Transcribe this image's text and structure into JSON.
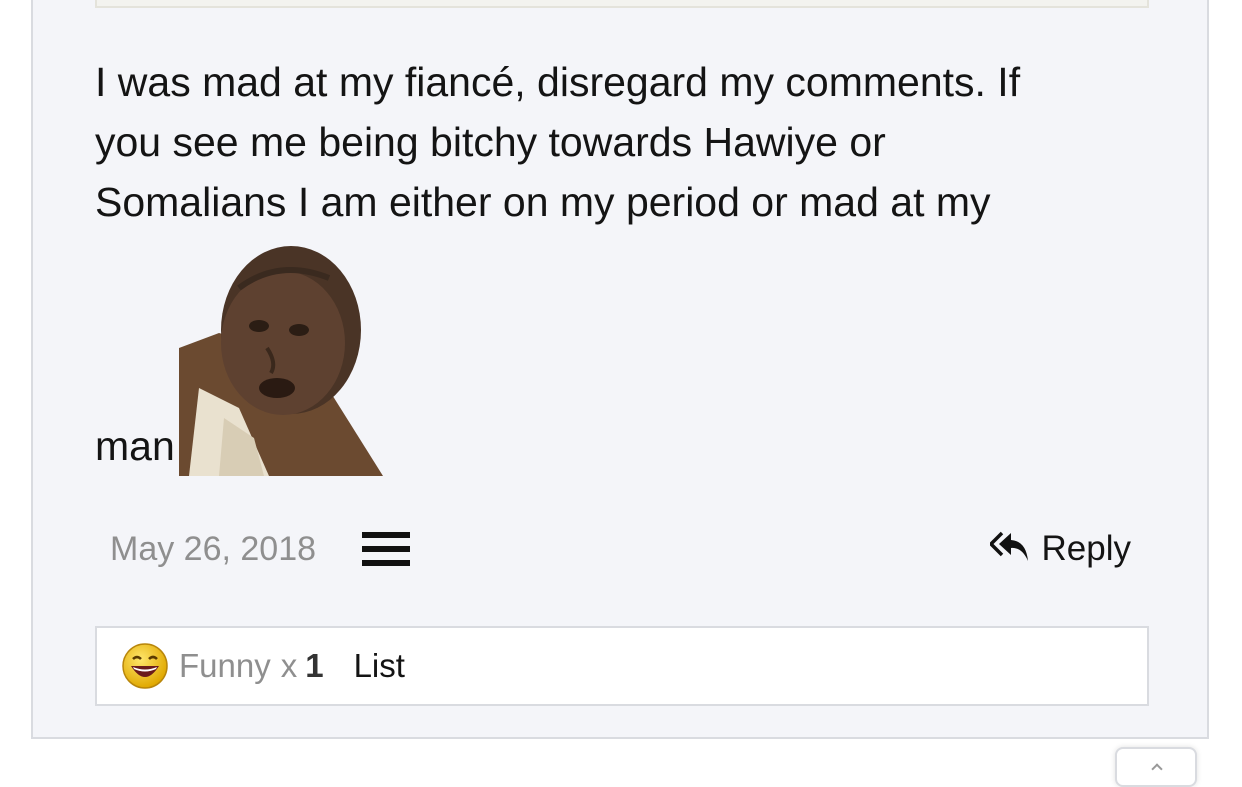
{
  "post": {
    "lines": [
      "I was mad at my fiancé, disregard my comments. If",
      "you see me being bitchy towards Hawiye or",
      "Somalians I am either on my period or mad at my"
    ],
    "last_word": "man",
    "smiley_icon": "sad-man-face-smiley-icon",
    "date": "May 26, 2018",
    "menu_icon": "hamburger-menu-icon",
    "reply_label": "Reply",
    "reply_icon": "reply-all-arrow-icon"
  },
  "reactions": {
    "emoji_icon": "laughing-face-icon",
    "name": "Funny",
    "multiplier": "x",
    "count": "1",
    "list_label": "List"
  },
  "colors": {
    "post_background": "#f4f5f9",
    "border": "#d9dbe0",
    "muted_text": "#8f8f8f",
    "emoji_yellow": "#f5c518"
  }
}
